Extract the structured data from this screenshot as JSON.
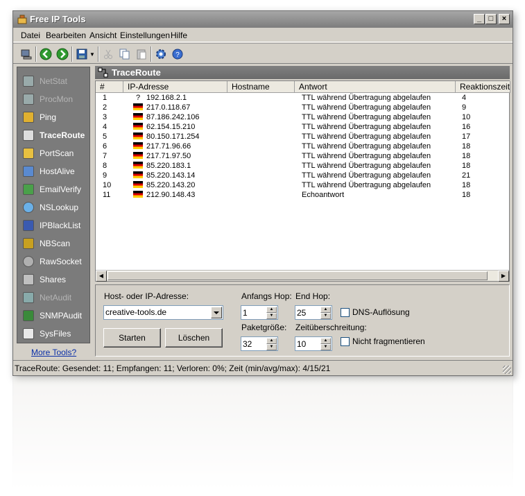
{
  "window": {
    "title": "Free IP Tools"
  },
  "menu": [
    "Datei",
    "Bearbeiten",
    "Ansicht",
    "Einstellungen",
    "Hilfe"
  ],
  "sidebar": {
    "items": [
      {
        "label": "NetStat",
        "icon": "netstat-icon"
      },
      {
        "label": "ProcMon",
        "icon": "procmon-icon"
      },
      {
        "label": "Ping",
        "icon": "ping-icon"
      },
      {
        "label": "TraceRoute",
        "icon": "traceroute-icon"
      },
      {
        "label": "PortScan",
        "icon": "portscan-icon"
      },
      {
        "label": "HostAlive",
        "icon": "hostalive-icon"
      },
      {
        "label": "EmailVerify",
        "icon": "emailverify-icon"
      },
      {
        "label": "NSLookup",
        "icon": "nslookup-icon"
      },
      {
        "label": "IPBlackList",
        "icon": "ipblacklist-icon"
      },
      {
        "label": "NBScan",
        "icon": "nbscan-icon"
      },
      {
        "label": "RawSocket",
        "icon": "rawsocket-icon"
      },
      {
        "label": "Shares",
        "icon": "shares-icon"
      },
      {
        "label": "NetAudit",
        "icon": "netaudit-icon"
      },
      {
        "label": "SNMPAudit",
        "icon": "snmpaudit-icon"
      },
      {
        "label": "SysFiles",
        "icon": "sysfiles-icon"
      }
    ],
    "more_tools": "More Tools?"
  },
  "panel": {
    "title": "TraceRoute"
  },
  "table": {
    "columns": [
      "#",
      "IP-Adresse",
      "Hostname",
      "Antwort",
      "Reaktionszeit"
    ],
    "rows": [
      {
        "n": "1",
        "ip": "192.168.2.1",
        "host": "",
        "answer": "TTL während Übertragung abgelaufen",
        "time": "4",
        "flag": "?"
      },
      {
        "n": "2",
        "ip": "217.0.118.67",
        "host": "",
        "answer": "TTL während Übertragung abgelaufen",
        "time": "9",
        "flag": "de"
      },
      {
        "n": "3",
        "ip": "87.186.242.106",
        "host": "",
        "answer": "TTL während Übertragung abgelaufen",
        "time": "10",
        "flag": "de"
      },
      {
        "n": "4",
        "ip": "62.154.15.210",
        "host": "",
        "answer": "TTL während Übertragung abgelaufen",
        "time": "16",
        "flag": "de"
      },
      {
        "n": "5",
        "ip": "80.150.171.254",
        "host": "",
        "answer": "TTL während Übertragung abgelaufen",
        "time": "17",
        "flag": "de"
      },
      {
        "n": "6",
        "ip": "217.71.96.66",
        "host": "",
        "answer": "TTL während Übertragung abgelaufen",
        "time": "18",
        "flag": "de"
      },
      {
        "n": "7",
        "ip": "217.71.97.50",
        "host": "",
        "answer": "TTL während Übertragung abgelaufen",
        "time": "18",
        "flag": "de"
      },
      {
        "n": "8",
        "ip": "85.220.183.1",
        "host": "",
        "answer": "TTL während Übertragung abgelaufen",
        "time": "18",
        "flag": "de"
      },
      {
        "n": "9",
        "ip": "85.220.143.14",
        "host": "",
        "answer": "TTL während Übertragung abgelaufen",
        "time": "21",
        "flag": "de"
      },
      {
        "n": "10",
        "ip": "85.220.143.20",
        "host": "",
        "answer": "TTL während Übertragung abgelaufen",
        "time": "18",
        "flag": "de"
      },
      {
        "n": "11",
        "ip": "212.90.148.43",
        "host": "",
        "answer": "Echoantwort",
        "time": "18",
        "flag": "de"
      }
    ]
  },
  "form": {
    "host_label": "Host- oder IP-Adresse:",
    "host_value": "creative-tools.de",
    "start_hop_label": "Anfangs Hop:",
    "start_hop_value": "1",
    "end_hop_label": "End Hop:",
    "end_hop_value": "25",
    "packet_label": "Paketgröße:",
    "packet_value": "32",
    "timeout_label": "Zeitüberschreitung:",
    "timeout_value": "10",
    "dns_label": "DNS-Auflösung",
    "nofrag_label": "Nicht fragmentieren",
    "start_button": "Starten",
    "clear_button": "Löschen"
  },
  "status": "TraceRoute: Gesendet: 11; Empfangen: 11; Verloren: 0%; Zeit (min/avg/max): 4/15/21"
}
